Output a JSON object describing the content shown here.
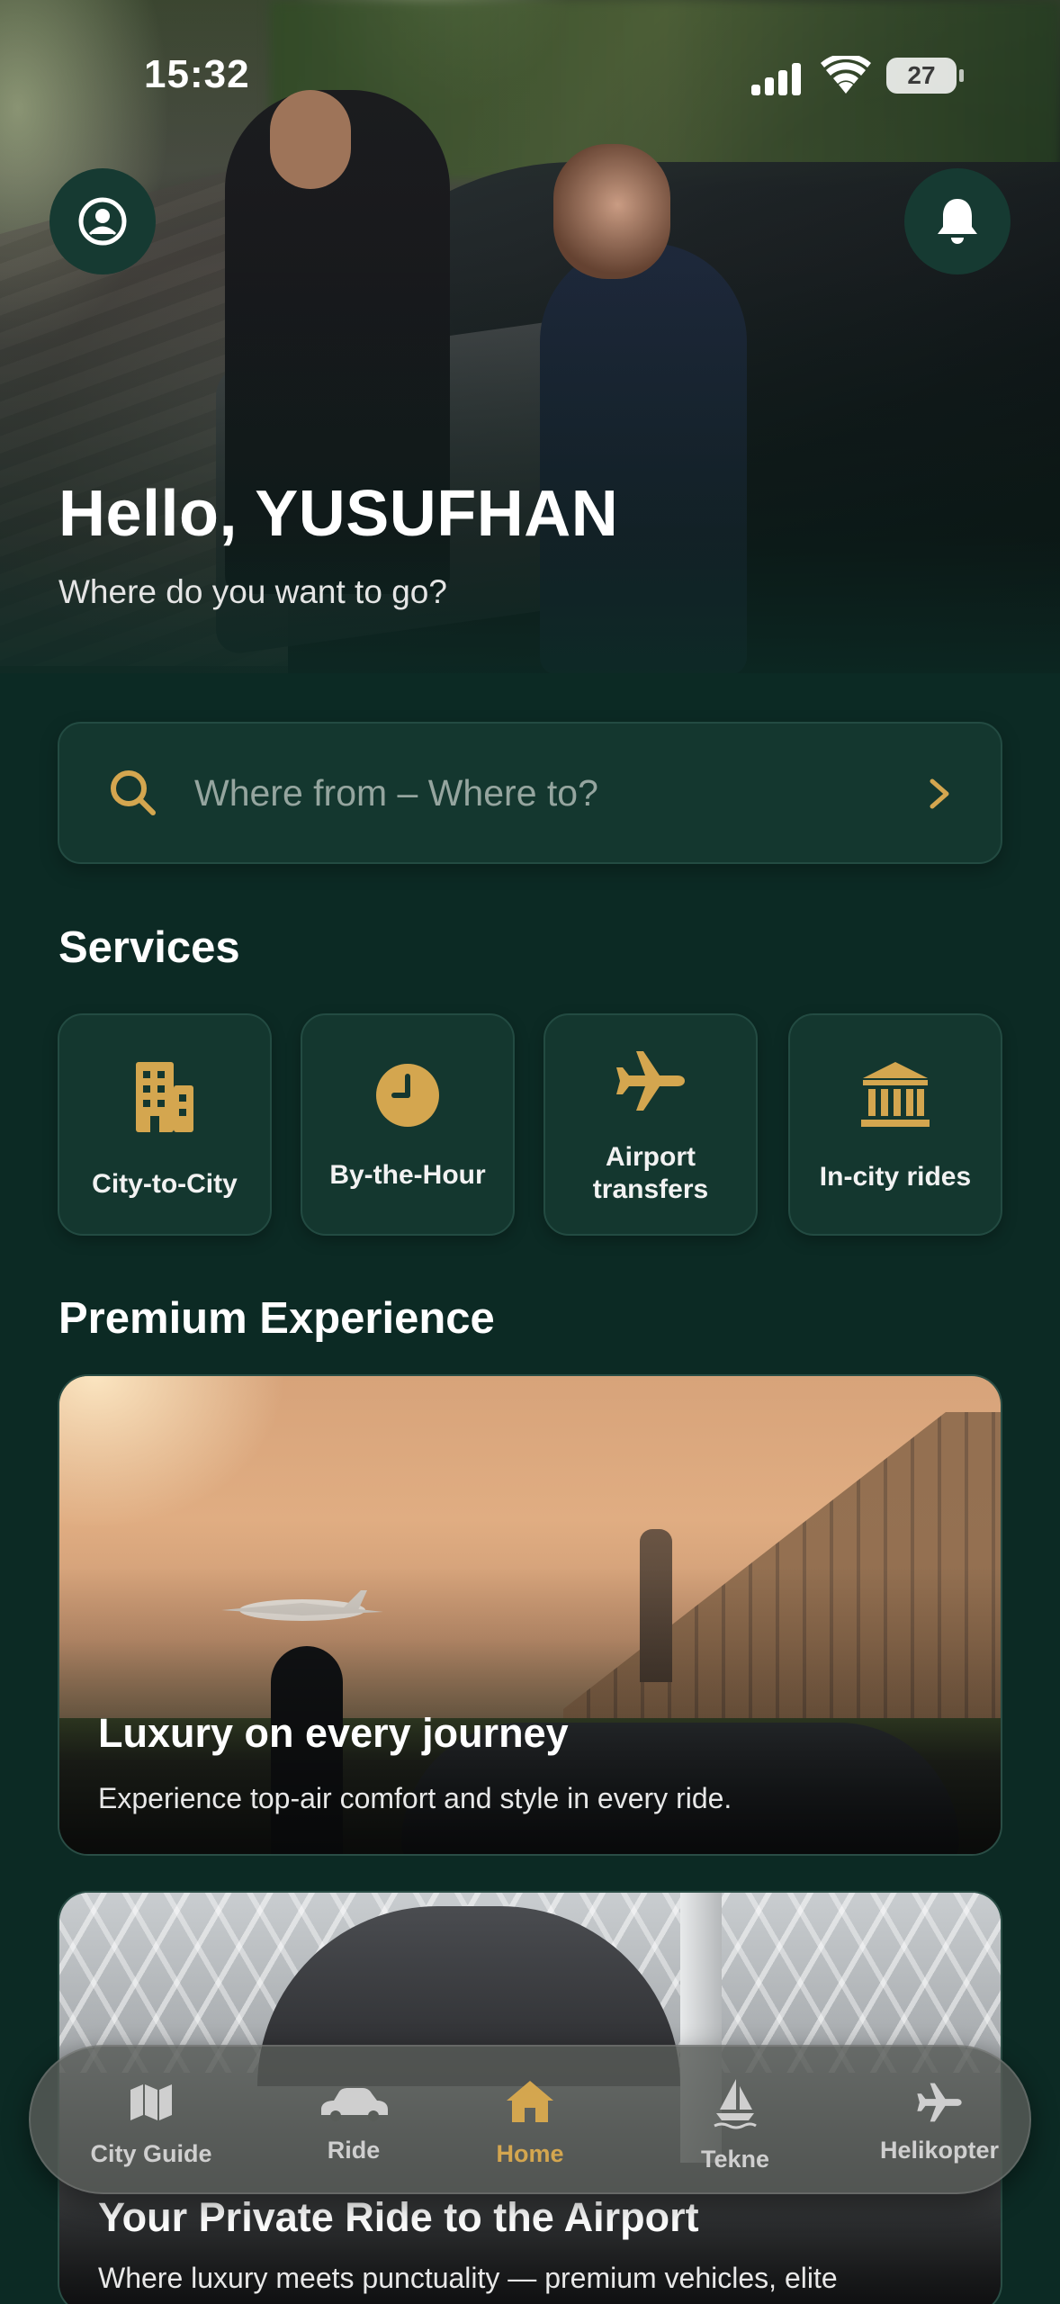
{
  "status_bar": {
    "time": "15:32",
    "battery": "27"
  },
  "hero": {
    "greeting": "Hello, YUSUFHAN",
    "subtitle": "Where do you want to go?"
  },
  "search": {
    "placeholder": "Where from – Where to?"
  },
  "services": {
    "title": "Services",
    "items": [
      {
        "label": "City-to-City",
        "icon": "buildings-icon"
      },
      {
        "label": "By-the-Hour",
        "icon": "clock-icon"
      },
      {
        "label_line1": "Airport",
        "label_line2": "transfers",
        "icon": "airplane-icon"
      },
      {
        "label": "In-city rides",
        "icon": "landmark-icon"
      }
    ]
  },
  "premium": {
    "title": "Premium Experience",
    "cards": [
      {
        "title": "Luxury on every journey",
        "subtitle": "Experience top-air comfort and style in every ride."
      },
      {
        "title": "Your Private Ride to the Airport",
        "subtitle": "Where luxury meets punctuality — premium vehicles, elite"
      }
    ]
  },
  "tab_bar": {
    "items": [
      {
        "label": "City Guide",
        "icon": "map-icon",
        "active": false
      },
      {
        "label": "Ride",
        "icon": "car-icon",
        "active": false
      },
      {
        "label": "Home",
        "icon": "home-icon",
        "active": true
      },
      {
        "label": "Tekne",
        "icon": "sailboat-icon",
        "active": false
      },
      {
        "label": "Helikopter",
        "icon": "plane-icon",
        "active": false
      }
    ]
  },
  "colors": {
    "background": "#0c2a24",
    "card": "#14372f",
    "accent": "#d4a64f"
  }
}
